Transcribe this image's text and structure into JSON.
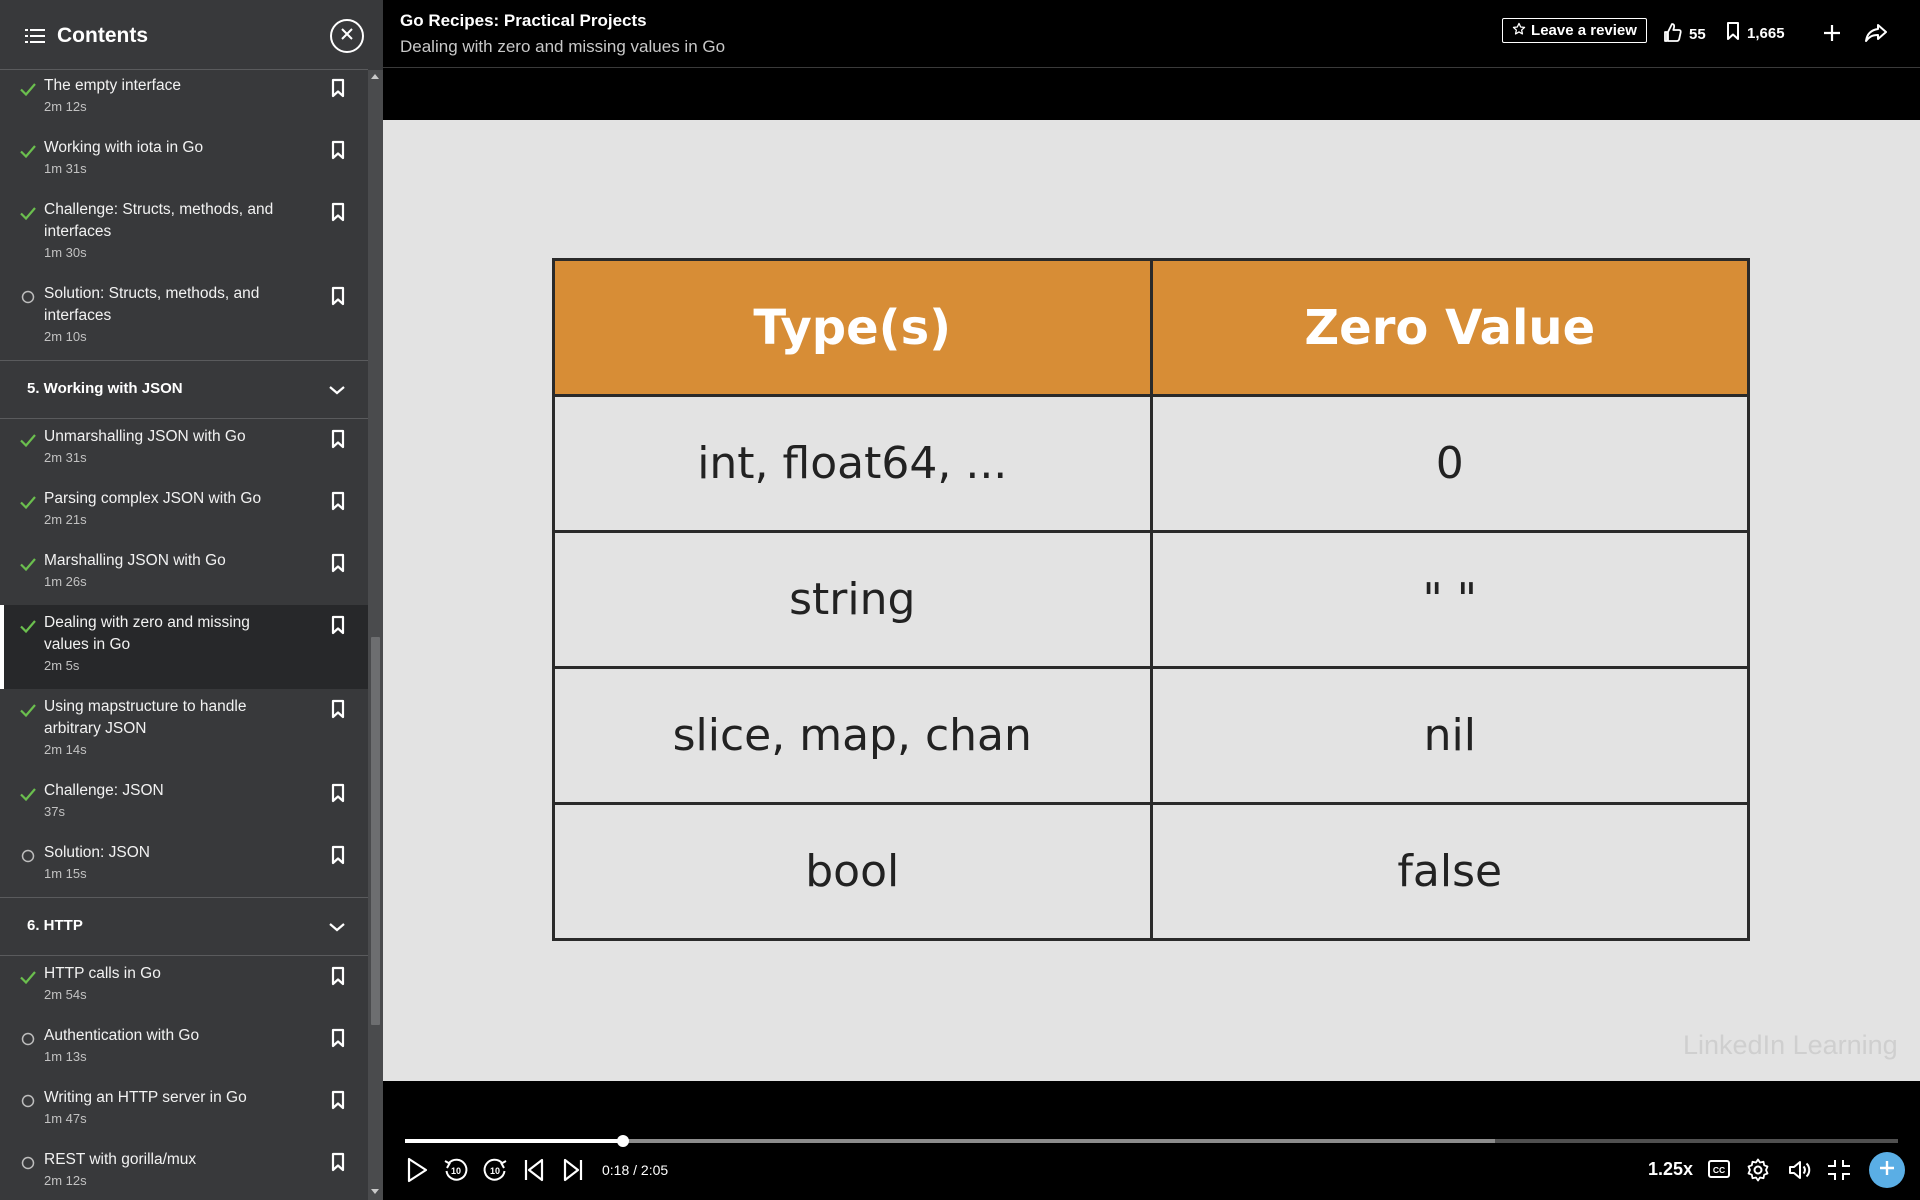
{
  "sidebar": {
    "title": "Contents",
    "blocks": [
      {
        "kind": "item",
        "title": "The empty interface",
        "duration": "2m 12s",
        "status": "done"
      },
      {
        "kind": "item",
        "title": "Working with iota in Go",
        "duration": "1m 31s",
        "status": "done"
      },
      {
        "kind": "item",
        "title": "Challenge: Structs, methods, and interfaces",
        "duration": "1m 30s",
        "status": "done"
      },
      {
        "kind": "item",
        "title": "Solution: Structs, methods, and interfaces",
        "duration": "2m 10s",
        "status": "todo"
      },
      {
        "kind": "chapter",
        "title": "5. Working with JSON"
      },
      {
        "kind": "item",
        "title": "Unmarshalling JSON with Go",
        "duration": "2m 31s",
        "status": "done"
      },
      {
        "kind": "item",
        "title": "Parsing complex JSON with Go",
        "duration": "2m 21s",
        "status": "done"
      },
      {
        "kind": "item",
        "title": "Marshalling JSON with Go",
        "duration": "1m 26s",
        "status": "done"
      },
      {
        "kind": "item",
        "title": "Dealing with zero and missing values in Go",
        "duration": "2m 5s",
        "status": "done",
        "active": true
      },
      {
        "kind": "item",
        "title": "Using mapstructure to handle arbitrary JSON",
        "duration": "2m 14s",
        "status": "done"
      },
      {
        "kind": "item",
        "title": "Challenge: JSON",
        "duration": "37s",
        "status": "done"
      },
      {
        "kind": "item",
        "title": "Solution: JSON",
        "duration": "1m 15s",
        "status": "todo"
      },
      {
        "kind": "chapter",
        "title": "6. HTTP"
      },
      {
        "kind": "item",
        "title": "HTTP calls in Go",
        "duration": "2m 54s",
        "status": "done"
      },
      {
        "kind": "item",
        "title": "Authentication with Go",
        "duration": "1m 13s",
        "status": "todo"
      },
      {
        "kind": "item",
        "title": "Writing an HTTP server in Go",
        "duration": "1m 47s",
        "status": "todo"
      },
      {
        "kind": "item",
        "title": "REST with gorilla/mux",
        "duration": "2m 12s",
        "status": "todo"
      }
    ]
  },
  "header": {
    "course_title": "Go Recipes: Practical Projects",
    "video_title": "Dealing with zero and missing values in Go",
    "review_label": "Leave a review",
    "likes": "55",
    "saves": "1,665"
  },
  "slide": {
    "columns": [
      "Type(s)",
      "Zero Value"
    ],
    "rows": [
      [
        "int, float64, ...",
        "0"
      ],
      [
        "string",
        "\" \""
      ],
      [
        "slice, map, chan",
        "nil"
      ],
      [
        "bool",
        "false"
      ]
    ],
    "watermark": "LinkedIn Learning"
  },
  "player": {
    "time_readout": "0:18 / 2:05",
    "progress": 0.146,
    "speed": "1.25x"
  },
  "colors": {
    "check": "#6bbf4e",
    "header_orange": "#d78d36",
    "fab": "#5aaee5"
  },
  "icons": [
    "list-icon",
    "close-icon",
    "check-icon",
    "circle-icon",
    "bookmark-icon",
    "chevron-down-icon",
    "star-icon",
    "like-icon",
    "plus-icon",
    "share-icon",
    "play-icon",
    "rewind-10-icon",
    "forward-10-icon",
    "previous-icon",
    "next-icon",
    "captions-icon",
    "gear-icon",
    "volume-icon",
    "exit-fullscreen-icon"
  ]
}
